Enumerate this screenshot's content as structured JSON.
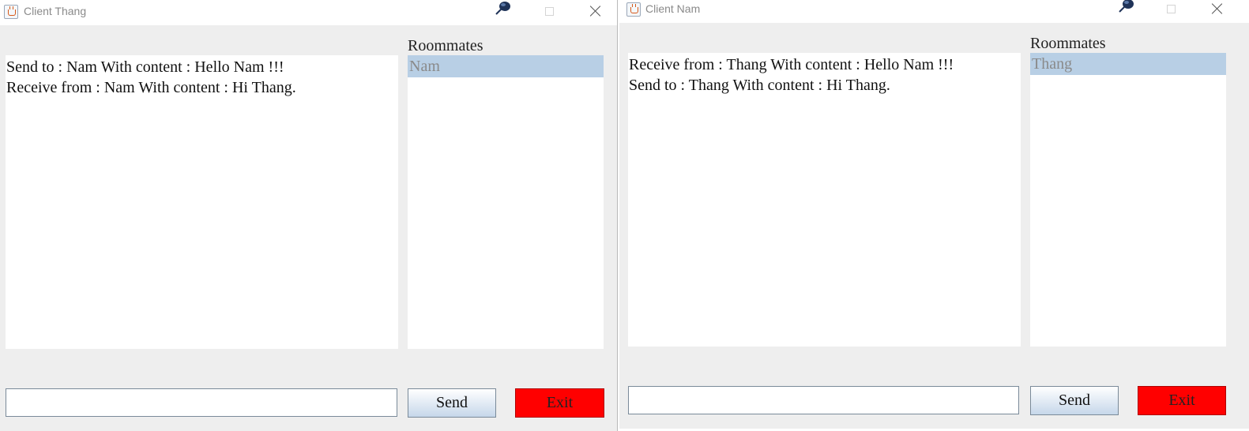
{
  "windows": [
    {
      "title": "Client Thang",
      "roommates_label": "Roommates",
      "messages": [
        "Send to : Nam With content : Hello Nam !!!",
        "Receive from : Nam With content : Hi Thang."
      ],
      "roommates": [
        "Nam"
      ],
      "input_value": "",
      "send_label": "Send",
      "exit_label": "Exit"
    },
    {
      "title": "Client Nam",
      "roommates_label": "Roommates",
      "messages": [
        "Receive from : Thang With content : Hello Nam !!!",
        "Send to : Thang With content : Hi Thang."
      ],
      "roommates": [
        "Thang"
      ],
      "input_value": "",
      "send_label": "Send",
      "exit_label": "Exit"
    }
  ],
  "colors": {
    "selected_item": "#b8cfe5",
    "exit_button": "#ff0000",
    "window_bg": "#eeeeee"
  },
  "icons": [
    "java-app-icon",
    "pin-icon",
    "maximize-icon",
    "close-icon"
  ]
}
